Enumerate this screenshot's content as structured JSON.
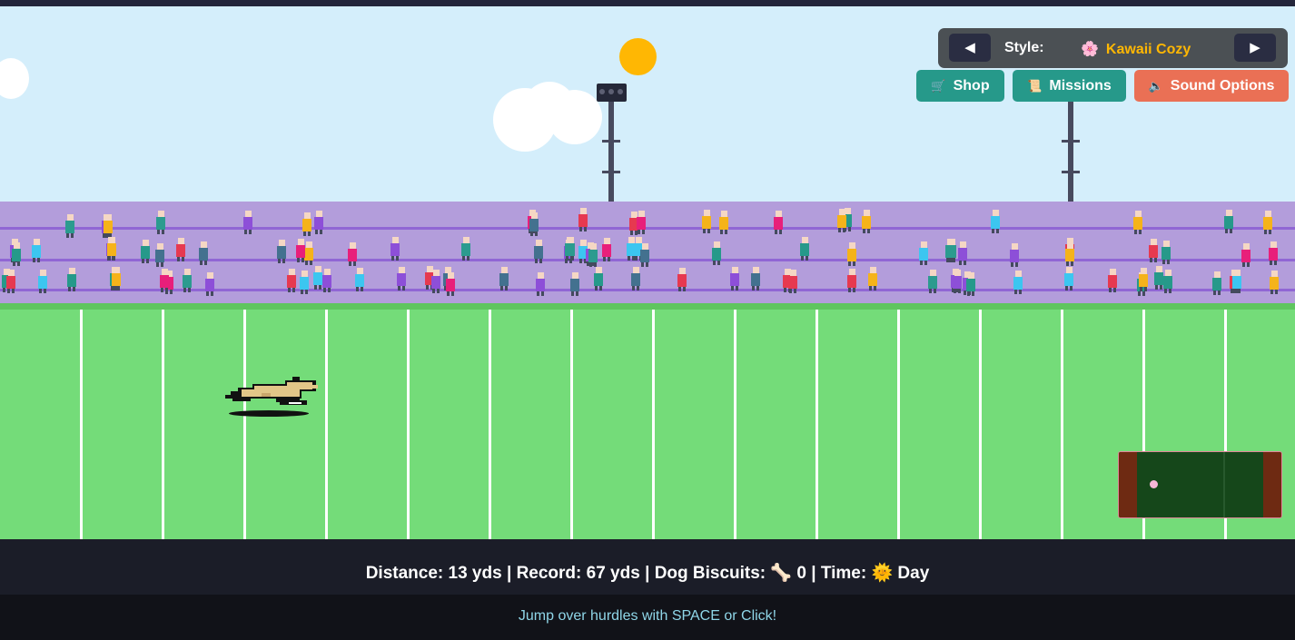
{
  "style_selector": {
    "prev_label": "◀",
    "label": "Style:",
    "icon": "🌸",
    "name": "Kawaii Cozy",
    "next_label": "▶"
  },
  "buttons": {
    "shop": {
      "icon": "🛒",
      "label": "Shop"
    },
    "missions": {
      "icon": "📜",
      "label": "Missions"
    },
    "sound": {
      "icon": "🔈",
      "label": "Sound Options"
    }
  },
  "status": {
    "distance_label": "Distance:",
    "distance_value": "13 yds",
    "record_label": "Record:",
    "record_value": "67 yds",
    "biscuits_label": "Dog Biscuits:",
    "biscuits_icon": "🦴",
    "biscuits_value": "0",
    "time_label": "Time:",
    "time_icon": "🌞",
    "time_value": "Day",
    "separator": "|"
  },
  "help_text": "Jump over hurdles with SPACE or Click!",
  "colors": {
    "sky": "#d4eefb",
    "stands": "#b39ddb",
    "field": "#74dc79",
    "sun": "#ffb703",
    "accent_teal": "#26998a",
    "accent_coral": "#ea7055"
  }
}
